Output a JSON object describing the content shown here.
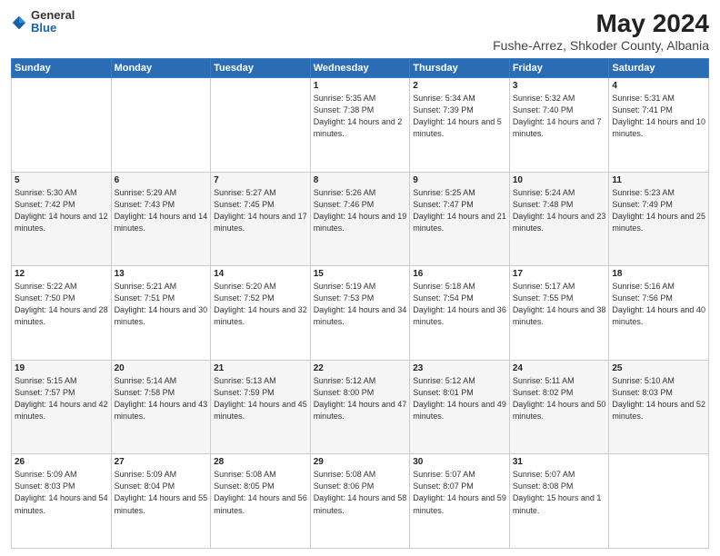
{
  "header": {
    "logo_general": "General",
    "logo_blue": "Blue",
    "title": "May 2024",
    "subtitle": "Fushe-Arrez, Shkoder County, Albania"
  },
  "weekdays": [
    "Sunday",
    "Monday",
    "Tuesday",
    "Wednesday",
    "Thursday",
    "Friday",
    "Saturday"
  ],
  "weeks": [
    [
      {
        "day": "",
        "sunrise": "",
        "sunset": "",
        "daylight": ""
      },
      {
        "day": "",
        "sunrise": "",
        "sunset": "",
        "daylight": ""
      },
      {
        "day": "",
        "sunrise": "",
        "sunset": "",
        "daylight": ""
      },
      {
        "day": "1",
        "sunrise": "Sunrise: 5:35 AM",
        "sunset": "Sunset: 7:38 PM",
        "daylight": "Daylight: 14 hours and 2 minutes."
      },
      {
        "day": "2",
        "sunrise": "Sunrise: 5:34 AM",
        "sunset": "Sunset: 7:39 PM",
        "daylight": "Daylight: 14 hours and 5 minutes."
      },
      {
        "day": "3",
        "sunrise": "Sunrise: 5:32 AM",
        "sunset": "Sunset: 7:40 PM",
        "daylight": "Daylight: 14 hours and 7 minutes."
      },
      {
        "day": "4",
        "sunrise": "Sunrise: 5:31 AM",
        "sunset": "Sunset: 7:41 PM",
        "daylight": "Daylight: 14 hours and 10 minutes."
      }
    ],
    [
      {
        "day": "5",
        "sunrise": "Sunrise: 5:30 AM",
        "sunset": "Sunset: 7:42 PM",
        "daylight": "Daylight: 14 hours and 12 minutes."
      },
      {
        "day": "6",
        "sunrise": "Sunrise: 5:29 AM",
        "sunset": "Sunset: 7:43 PM",
        "daylight": "Daylight: 14 hours and 14 minutes."
      },
      {
        "day": "7",
        "sunrise": "Sunrise: 5:27 AM",
        "sunset": "Sunset: 7:45 PM",
        "daylight": "Daylight: 14 hours and 17 minutes."
      },
      {
        "day": "8",
        "sunrise": "Sunrise: 5:26 AM",
        "sunset": "Sunset: 7:46 PM",
        "daylight": "Daylight: 14 hours and 19 minutes."
      },
      {
        "day": "9",
        "sunrise": "Sunrise: 5:25 AM",
        "sunset": "Sunset: 7:47 PM",
        "daylight": "Daylight: 14 hours and 21 minutes."
      },
      {
        "day": "10",
        "sunrise": "Sunrise: 5:24 AM",
        "sunset": "Sunset: 7:48 PM",
        "daylight": "Daylight: 14 hours and 23 minutes."
      },
      {
        "day": "11",
        "sunrise": "Sunrise: 5:23 AM",
        "sunset": "Sunset: 7:49 PM",
        "daylight": "Daylight: 14 hours and 25 minutes."
      }
    ],
    [
      {
        "day": "12",
        "sunrise": "Sunrise: 5:22 AM",
        "sunset": "Sunset: 7:50 PM",
        "daylight": "Daylight: 14 hours and 28 minutes."
      },
      {
        "day": "13",
        "sunrise": "Sunrise: 5:21 AM",
        "sunset": "Sunset: 7:51 PM",
        "daylight": "Daylight: 14 hours and 30 minutes."
      },
      {
        "day": "14",
        "sunrise": "Sunrise: 5:20 AM",
        "sunset": "Sunset: 7:52 PM",
        "daylight": "Daylight: 14 hours and 32 minutes."
      },
      {
        "day": "15",
        "sunrise": "Sunrise: 5:19 AM",
        "sunset": "Sunset: 7:53 PM",
        "daylight": "Daylight: 14 hours and 34 minutes."
      },
      {
        "day": "16",
        "sunrise": "Sunrise: 5:18 AM",
        "sunset": "Sunset: 7:54 PM",
        "daylight": "Daylight: 14 hours and 36 minutes."
      },
      {
        "day": "17",
        "sunrise": "Sunrise: 5:17 AM",
        "sunset": "Sunset: 7:55 PM",
        "daylight": "Daylight: 14 hours and 38 minutes."
      },
      {
        "day": "18",
        "sunrise": "Sunrise: 5:16 AM",
        "sunset": "Sunset: 7:56 PM",
        "daylight": "Daylight: 14 hours and 40 minutes."
      }
    ],
    [
      {
        "day": "19",
        "sunrise": "Sunrise: 5:15 AM",
        "sunset": "Sunset: 7:57 PM",
        "daylight": "Daylight: 14 hours and 42 minutes."
      },
      {
        "day": "20",
        "sunrise": "Sunrise: 5:14 AM",
        "sunset": "Sunset: 7:58 PM",
        "daylight": "Daylight: 14 hours and 43 minutes."
      },
      {
        "day": "21",
        "sunrise": "Sunrise: 5:13 AM",
        "sunset": "Sunset: 7:59 PM",
        "daylight": "Daylight: 14 hours and 45 minutes."
      },
      {
        "day": "22",
        "sunrise": "Sunrise: 5:12 AM",
        "sunset": "Sunset: 8:00 PM",
        "daylight": "Daylight: 14 hours and 47 minutes."
      },
      {
        "day": "23",
        "sunrise": "Sunrise: 5:12 AM",
        "sunset": "Sunset: 8:01 PM",
        "daylight": "Daylight: 14 hours and 49 minutes."
      },
      {
        "day": "24",
        "sunrise": "Sunrise: 5:11 AM",
        "sunset": "Sunset: 8:02 PM",
        "daylight": "Daylight: 14 hours and 50 minutes."
      },
      {
        "day": "25",
        "sunrise": "Sunrise: 5:10 AM",
        "sunset": "Sunset: 8:03 PM",
        "daylight": "Daylight: 14 hours and 52 minutes."
      }
    ],
    [
      {
        "day": "26",
        "sunrise": "Sunrise: 5:09 AM",
        "sunset": "Sunset: 8:03 PM",
        "daylight": "Daylight: 14 hours and 54 minutes."
      },
      {
        "day": "27",
        "sunrise": "Sunrise: 5:09 AM",
        "sunset": "Sunset: 8:04 PM",
        "daylight": "Daylight: 14 hours and 55 minutes."
      },
      {
        "day": "28",
        "sunrise": "Sunrise: 5:08 AM",
        "sunset": "Sunset: 8:05 PM",
        "daylight": "Daylight: 14 hours and 56 minutes."
      },
      {
        "day": "29",
        "sunrise": "Sunrise: 5:08 AM",
        "sunset": "Sunset: 8:06 PM",
        "daylight": "Daylight: 14 hours and 58 minutes."
      },
      {
        "day": "30",
        "sunrise": "Sunrise: 5:07 AM",
        "sunset": "Sunset: 8:07 PM",
        "daylight": "Daylight: 14 hours and 59 minutes."
      },
      {
        "day": "31",
        "sunrise": "Sunrise: 5:07 AM",
        "sunset": "Sunset: 8:08 PM",
        "daylight": "Daylight: 15 hours and 1 minute."
      },
      {
        "day": "",
        "sunrise": "",
        "sunset": "",
        "daylight": ""
      }
    ]
  ]
}
